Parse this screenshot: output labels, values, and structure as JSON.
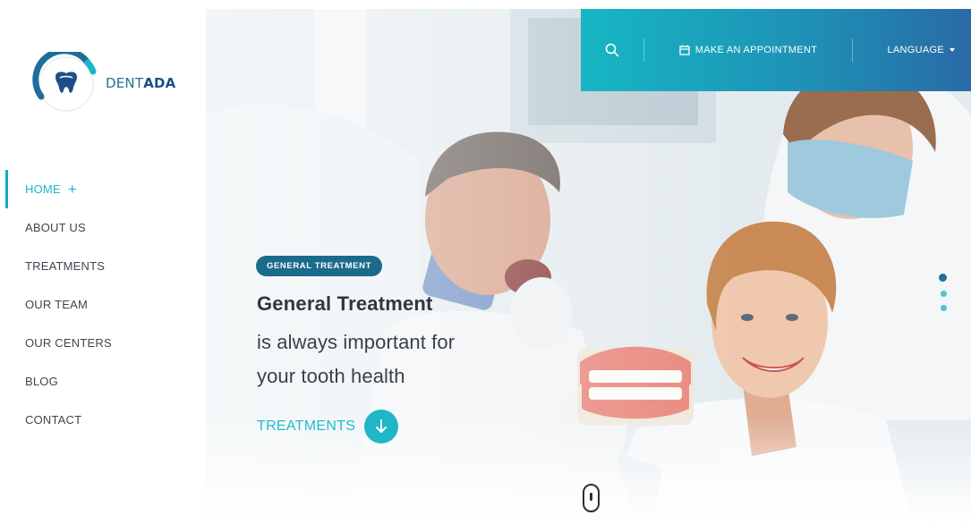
{
  "brand": {
    "name_light": "DENT",
    "name_bold": "ADA"
  },
  "topbar": {
    "search_icon": "search-icon",
    "appointment_label": "MAKE AN APPOINTMENT",
    "language_label": "LANGUAGE"
  },
  "nav": {
    "items": [
      {
        "label": "HOME",
        "active": true
      },
      {
        "label": "ABOUT US",
        "active": false
      },
      {
        "label": "TREATMENTS",
        "active": false
      },
      {
        "label": "OUR TEAM",
        "active": false
      },
      {
        "label": "OUR CENTERS",
        "active": false
      },
      {
        "label": "BLOG",
        "active": false
      },
      {
        "label": "CONTACT",
        "active": false
      }
    ],
    "active_indicator": "+"
  },
  "slide": {
    "badge": "GENERAL TREATMENT",
    "headline": "General Treatment",
    "subline_1": "is always important for",
    "subline_2": "your tooth health",
    "cta_label": "TREATMENTS"
  },
  "colors": {
    "accent": "#19b6c9",
    "brand_dark": "#1d4e89",
    "badge_bg": "#1b6b8a",
    "topbar_start": "#17b7c4",
    "topbar_end": "#2a6aa6"
  }
}
